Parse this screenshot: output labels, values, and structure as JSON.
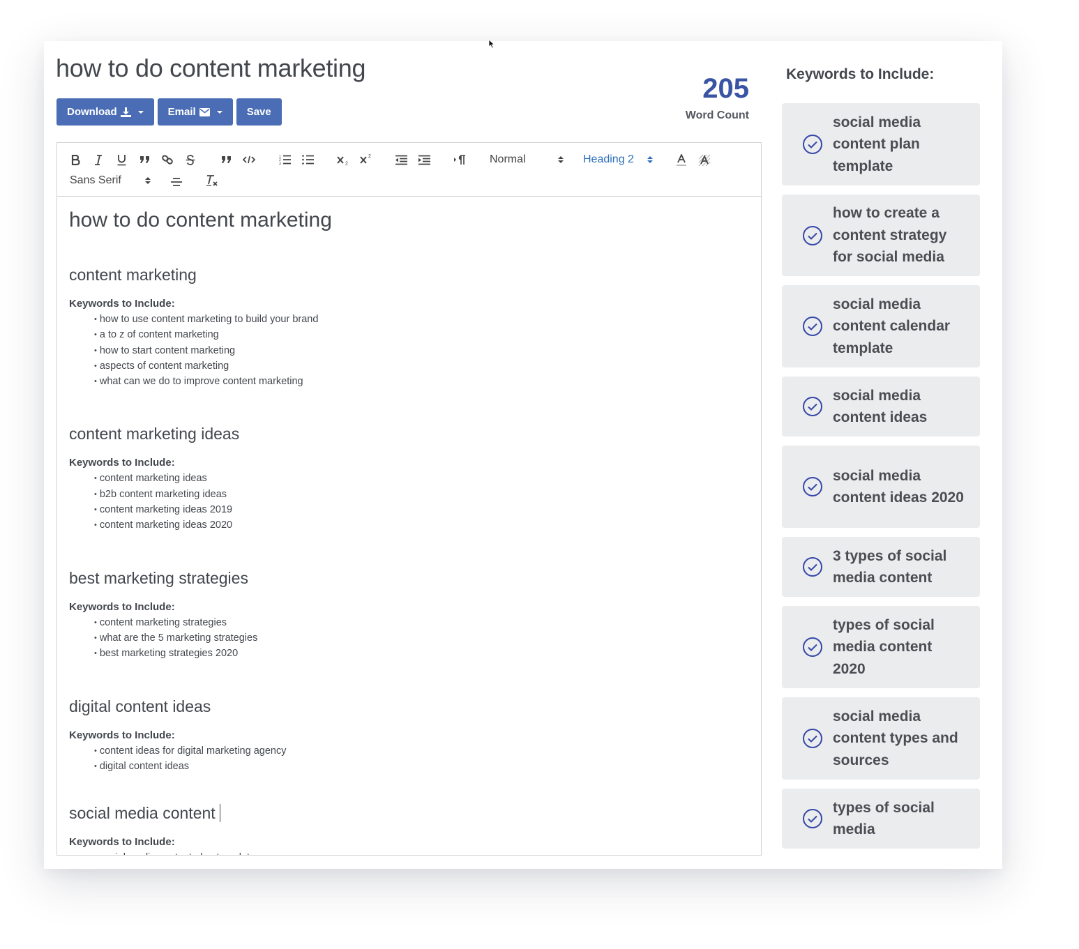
{
  "document": {
    "title": "how to do content marketing"
  },
  "toolbar": {
    "download_label": "Download",
    "email_label": "Email",
    "save_label": "Save"
  },
  "word_count": {
    "value": "205",
    "label": "Word Count"
  },
  "editor_toolbar": {
    "buttons": [
      "bold",
      "italic",
      "underline",
      "blockquote",
      "link",
      "strike",
      "quote",
      "code",
      "ordered-list",
      "bullet-list",
      "subscript",
      "superscript",
      "outdent",
      "indent",
      "text-direction",
      "header-select",
      "size-select",
      "text-color",
      "background-color",
      "font-select",
      "align",
      "clean"
    ],
    "format_select": "Normal",
    "heading_select": "Heading 2",
    "font_select": "Sans Serif",
    "active_color": "#2c6fbb"
  },
  "editor": {
    "heading": "how to do content marketing",
    "keywords_label": "Keywords to Include:",
    "sections": [
      {
        "title": "content marketing",
        "keywords": [
          "how to use content marketing to build your brand",
          "a to z of content marketing",
          "how to start content marketing",
          "aspects of content marketing",
          "what can we do to improve content marketing"
        ]
      },
      {
        "title": "content marketing ideas",
        "keywords": [
          "content marketing ideas",
          "b2b content marketing ideas",
          "content marketing ideas 2019",
          "content marketing ideas 2020"
        ]
      },
      {
        "title": "best marketing strategies",
        "keywords": [
          "content marketing strategies",
          "what are the 5 marketing strategies",
          "best marketing strategies 2020"
        ]
      },
      {
        "title": "digital content ideas",
        "keywords": [
          "content ideas for digital marketing agency",
          "digital content ideas"
        ]
      },
      {
        "title": "social media content",
        "keywords": [
          "social media content plan template"
        ]
      }
    ]
  },
  "sidebar": {
    "title": "Keywords to Include:",
    "check_color": "#3446a8",
    "keywords": [
      "social media content plan template",
      "how to create a content strategy for social media",
      "social media content calendar template",
      "social media content ideas",
      "social media content ideas 2020",
      "3 types of social media content",
      "types of social media content 2020",
      "social media content types and sources",
      "types of social media"
    ]
  },
  "colors": {
    "primary_button": "#4a6db5",
    "word_count": "#3a54a4",
    "card_bg": "#ebecee"
  }
}
